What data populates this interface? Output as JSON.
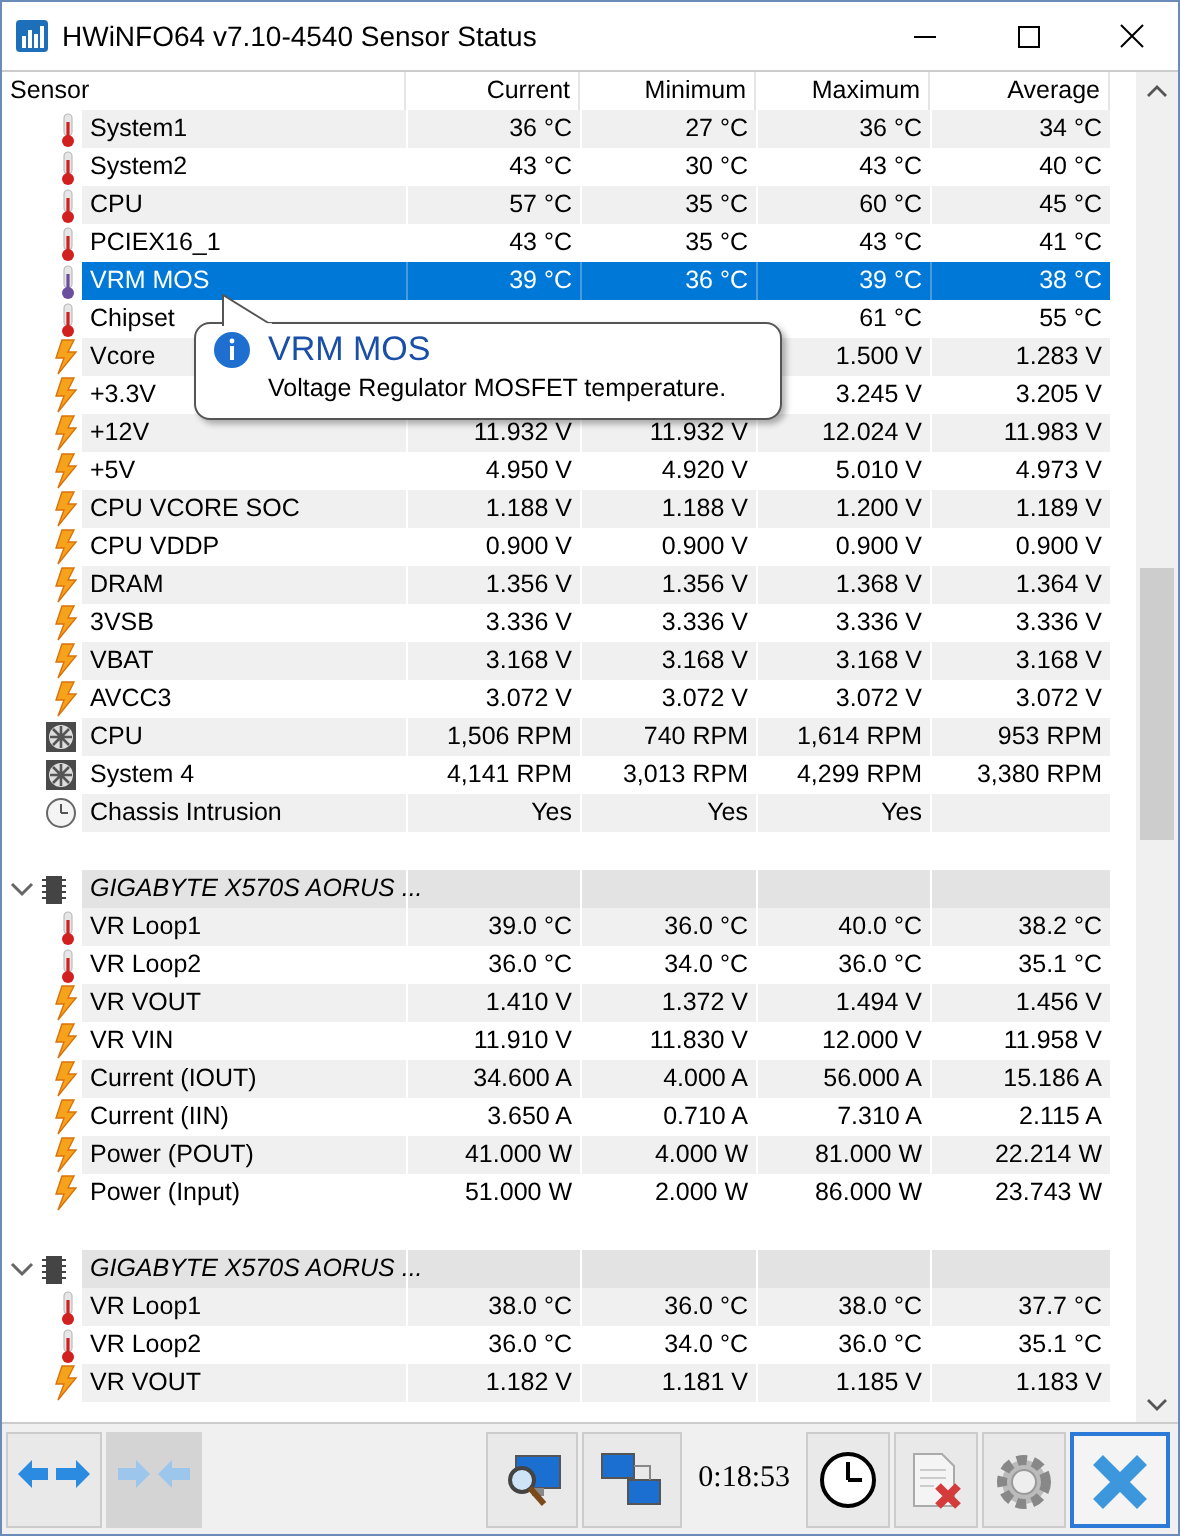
{
  "window": {
    "title": "HWiNFO64 v7.10-4540 Sensor Status"
  },
  "columns": [
    "Sensor",
    "Current",
    "Minimum",
    "Maximum",
    "Average"
  ],
  "rows": [
    {
      "kind": "temperature",
      "name": "System1",
      "values": [
        "36 °C",
        "27 °C",
        "36 °C",
        "34 °C"
      ],
      "selected": false
    },
    {
      "kind": "temperature",
      "name": "System2",
      "values": [
        "43 °C",
        "30 °C",
        "43 °C",
        "40 °C"
      ],
      "selected": false
    },
    {
      "kind": "temperature",
      "name": "CPU",
      "values": [
        "57 °C",
        "35 °C",
        "60 °C",
        "45 °C"
      ],
      "selected": false
    },
    {
      "kind": "temperature",
      "name": "PCIEX16_1",
      "values": [
        "43 °C",
        "35 °C",
        "43 °C",
        "41 °C"
      ],
      "selected": false
    },
    {
      "kind": "temperature",
      "name": "VRM MOS",
      "values": [
        "39 °C",
        "36 °C",
        "39 °C",
        "38 °C"
      ],
      "selected": true
    },
    {
      "kind": "temperature",
      "name": "Chipset",
      "values": {
        "maximum": "61 °C",
        "average": "55 °C"
      },
      "selected": false
    },
    {
      "kind": "voltage",
      "name": "Vcore",
      "values": {
        "maximum": "1.500 V",
        "average": "1.283 V"
      },
      "selected": false
    },
    {
      "kind": "voltage",
      "name": "+3.3V",
      "values": {
        "maximum": "3.245 V",
        "average": "3.205 V"
      },
      "selected": false
    },
    {
      "kind": "voltage",
      "name": "+12V",
      "values": [
        "11.932 V",
        "11.932 V",
        "12.024 V",
        "11.983 V"
      ],
      "selected": false
    },
    {
      "kind": "voltage",
      "name": "+5V",
      "values": [
        "4.950 V",
        "4.920 V",
        "5.010 V",
        "4.973 V"
      ],
      "selected": false
    },
    {
      "kind": "voltage",
      "name": "CPU VCORE SOC",
      "values": [
        "1.188 V",
        "1.188 V",
        "1.200 V",
        "1.189 V"
      ],
      "selected": false
    },
    {
      "kind": "voltage",
      "name": "CPU VDDP",
      "values": [
        "0.900 V",
        "0.900 V",
        "0.900 V",
        "0.900 V"
      ],
      "selected": false
    },
    {
      "kind": "voltage",
      "name": "DRAM",
      "values": [
        "1.356 V",
        "1.356 V",
        "1.368 V",
        "1.364 V"
      ],
      "selected": false
    },
    {
      "kind": "voltage",
      "name": "3VSB",
      "values": [
        "3.336 V",
        "3.336 V",
        "3.336 V",
        "3.336 V"
      ],
      "selected": false
    },
    {
      "kind": "voltage",
      "name": "VBAT",
      "values": [
        "3.168 V",
        "3.168 V",
        "3.168 V",
        "3.168 V"
      ],
      "selected": false
    },
    {
      "kind": "voltage",
      "name": "AVCC3",
      "values": [
        "3.072 V",
        "3.072 V",
        "3.072 V",
        "3.072 V"
      ],
      "selected": false
    },
    {
      "kind": "fan",
      "name": "CPU",
      "values": [
        "1,506 RPM",
        "740 RPM",
        "1,614 RPM",
        "953 RPM"
      ],
      "selected": false
    },
    {
      "kind": "fan",
      "name": "System 4",
      "values": [
        "4,141 RPM",
        "3,013 RPM",
        "4,299 RPM",
        "3,380 RPM"
      ],
      "selected": false
    },
    {
      "kind": "intrusion",
      "name": "Chassis Intrusion",
      "values": {
        "current": "Yes",
        "minimum": "Yes",
        "maximum": "Yes"
      },
      "selected": false
    },
    {
      "kind": "spacer"
    },
    {
      "kind": "group",
      "name": "GIGABYTE X570S AORUS ...",
      "expanded": true
    },
    {
      "kind": "temperature",
      "name": "VR Loop1",
      "values": [
        "39.0 °C",
        "36.0 °C",
        "40.0 °C",
        "38.2 °C"
      ],
      "selected": false
    },
    {
      "kind": "temperature",
      "name": "VR Loop2",
      "values": [
        "36.0 °C",
        "34.0 °C",
        "36.0 °C",
        "35.1 °C"
      ],
      "selected": false
    },
    {
      "kind": "voltage",
      "name": "VR VOUT",
      "values": [
        "1.410 V",
        "1.372 V",
        "1.494 V",
        "1.456 V"
      ],
      "selected": false
    },
    {
      "kind": "voltage",
      "name": "VR VIN",
      "values": [
        "11.910 V",
        "11.830 V",
        "12.000 V",
        "11.958 V"
      ],
      "selected": false
    },
    {
      "kind": "voltage",
      "name": "Current (IOUT)",
      "values": [
        "34.600 A",
        "4.000 A",
        "56.000 A",
        "15.186 A"
      ],
      "selected": false
    },
    {
      "kind": "voltage",
      "name": "Current (IIN)",
      "values": [
        "3.650 A",
        "0.710 A",
        "7.310 A",
        "2.115 A"
      ],
      "selected": false
    },
    {
      "kind": "voltage",
      "name": "Power (POUT)",
      "values": [
        "41.000 W",
        "4.000 W",
        "81.000 W",
        "22.214 W"
      ],
      "selected": false
    },
    {
      "kind": "voltage",
      "name": "Power (Input)",
      "values": [
        "51.000 W",
        "2.000 W",
        "86.000 W",
        "23.743 W"
      ],
      "selected": false
    },
    {
      "kind": "spacer"
    },
    {
      "kind": "group",
      "name": "GIGABYTE X570S AORUS ...",
      "expanded": true
    },
    {
      "kind": "temperature",
      "name": "VR Loop1",
      "values": [
        "38.0 °C",
        "36.0 °C",
        "38.0 °C",
        "37.7 °C"
      ],
      "selected": false
    },
    {
      "kind": "temperature",
      "name": "VR Loop2",
      "values": [
        "36.0 °C",
        "34.0 °C",
        "36.0 °C",
        "35.1 °C"
      ],
      "selected": false
    },
    {
      "kind": "voltage",
      "name": "VR VOUT",
      "values": [
        "1.182 V",
        "1.181 V",
        "1.185 V",
        "1.183 V"
      ],
      "selected": false
    }
  ],
  "tooltip": {
    "title": "VRM MOS",
    "text": "Voltage Regulator MOSFET temperature."
  },
  "toolbar": [
    {
      "kind": "expand",
      "disabled": false,
      "focused": false
    },
    {
      "kind": "collapse",
      "disabled": true,
      "focused": false
    },
    {
      "kind": "gap"
    },
    {
      "kind": "monitor",
      "disabled": false,
      "focused": false
    },
    {
      "kind": "network",
      "disabled": false,
      "focused": false
    },
    {
      "kind": "timer",
      "text": "0:18:53"
    },
    {
      "kind": "clock",
      "disabled": false,
      "focused": false
    },
    {
      "kind": "report",
      "disabled": false,
      "focused": false
    },
    {
      "kind": "settings",
      "disabled": false,
      "focused": false
    },
    {
      "kind": "close",
      "disabled": false,
      "focused": true
    }
  ]
}
